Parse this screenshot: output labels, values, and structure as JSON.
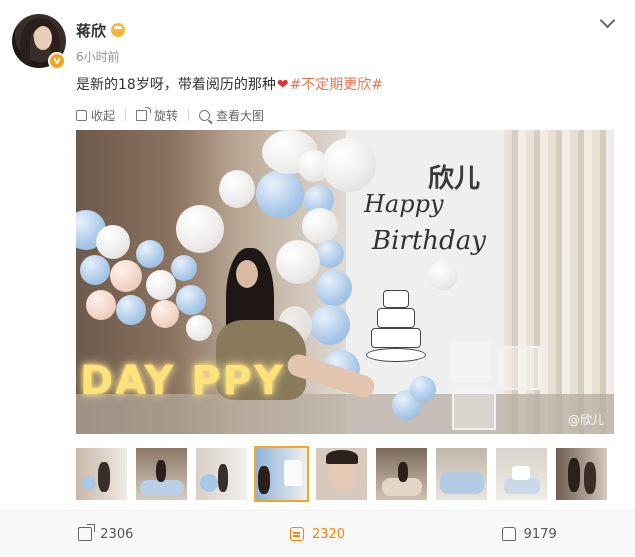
{
  "post": {
    "username": "蒋欣",
    "time": "6小时前",
    "text_before": "是新的18岁呀，带着阅历的那种",
    "heart": "❤",
    "topic": "#不定期更欣#",
    "verified_mark": "v"
  },
  "toolbar": {
    "collapse_label": "收起",
    "rotate_label": "旋转",
    "view_large_label": "查看大图"
  },
  "photo": {
    "name_text": "欣儿",
    "happy_text": "Happy",
    "birthday_text": "Birthday",
    "letters_text": "DAY PPY",
    "watermark": "@欣儿"
  },
  "thumbnails": {
    "count": 9,
    "active_index": 3
  },
  "actions": {
    "repost_count": "2306",
    "comment_count": "2320",
    "like_count": "9179"
  },
  "colors": {
    "accent": "#ff8200",
    "topic": "#eb7350",
    "vip": "#f7a21b"
  }
}
